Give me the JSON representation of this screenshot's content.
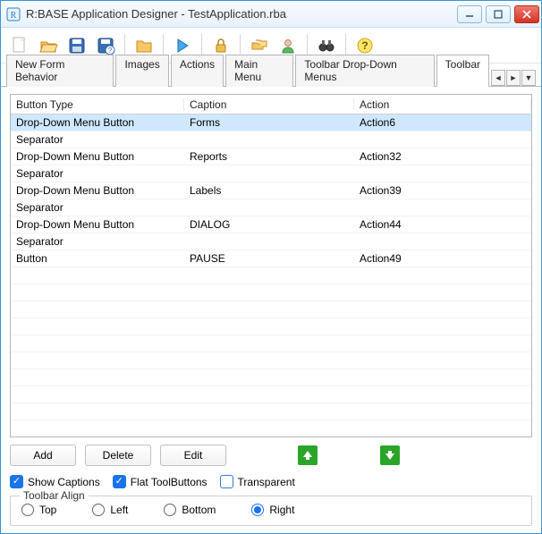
{
  "window": {
    "title": "R:BASE Application Designer - TestApplication.rba"
  },
  "tabs": {
    "items": [
      "New Form Behavior",
      "Images",
      "Actions",
      "Main Menu",
      "Toolbar Drop-Down Menus",
      "Toolbar"
    ],
    "active_index": 5
  },
  "grid": {
    "headers": {
      "type": "Button Type",
      "caption": "Caption",
      "action": "Action"
    },
    "rows": [
      {
        "type": "Drop-Down Menu Button",
        "caption": "Forms",
        "action": "Action6",
        "selected": true
      },
      {
        "type": "Separator",
        "caption": "",
        "action": ""
      },
      {
        "type": "Drop-Down Menu Button",
        "caption": "Reports",
        "action": "Action32"
      },
      {
        "type": "Separator",
        "caption": "",
        "action": ""
      },
      {
        "type": "Drop-Down Menu Button",
        "caption": "Labels",
        "action": "Action39"
      },
      {
        "type": "Separator",
        "caption": "",
        "action": ""
      },
      {
        "type": "Drop-Down Menu Button",
        "caption": "DIALOG",
        "action": "Action44"
      },
      {
        "type": "Separator",
        "caption": "",
        "action": ""
      },
      {
        "type": "Button",
        "caption": "PAUSE",
        "action": "Action49"
      }
    ]
  },
  "buttons": {
    "add": "Add",
    "delete": "Delete",
    "edit": "Edit"
  },
  "checks": {
    "show_captions": {
      "label": "Show Captions",
      "checked": true
    },
    "flat_toolbuttons": {
      "label": "Flat ToolButtons",
      "checked": true
    },
    "transparent": {
      "label": "Transparent",
      "checked": false
    }
  },
  "align": {
    "legend": "Toolbar Align",
    "options": [
      {
        "label": "Top",
        "checked": false
      },
      {
        "label": "Left",
        "checked": false
      },
      {
        "label": "Bottom",
        "checked": false
      },
      {
        "label": "Right",
        "checked": true
      }
    ]
  }
}
